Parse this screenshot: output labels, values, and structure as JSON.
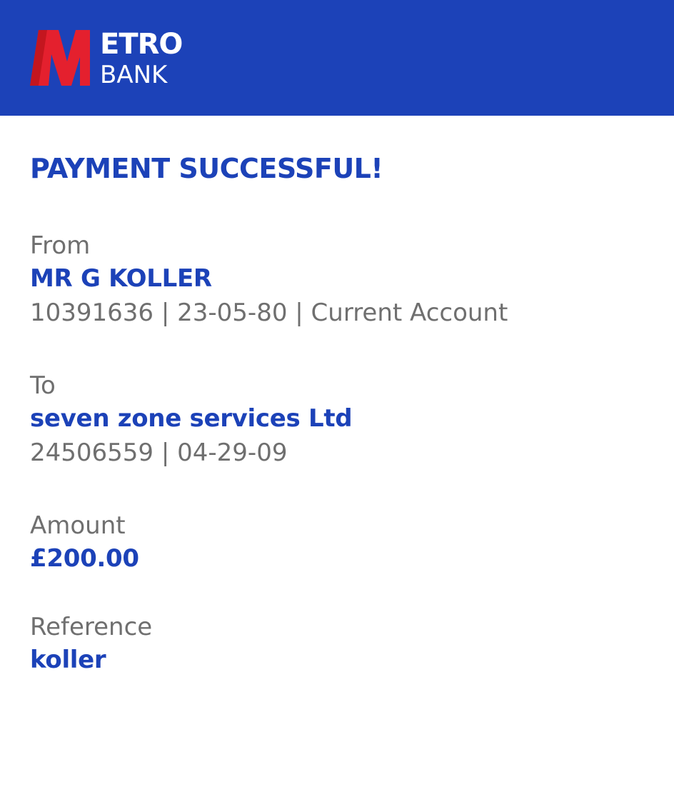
{
  "brand": {
    "word_top": "ETRO",
    "word_bottom": "BANK",
    "colors": {
      "header_bg": "#1c42b8",
      "logo_red": "#e4202e",
      "text_blue": "#1c42b8",
      "text_grey": "#6f6f6f"
    }
  },
  "receipt": {
    "title": "PAYMENT SUCCESSFUL!",
    "from": {
      "label": "From",
      "name": "MR G KOLLER",
      "details": "10391636 | 23-05-80 | Current Account"
    },
    "to": {
      "label": "To",
      "name": "seven zone services Ltd",
      "details": "24506559 | 04-29-09"
    },
    "amount": {
      "label": "Amount",
      "value": "£200.00"
    },
    "reference": {
      "label": "Reference",
      "value": "koller"
    }
  }
}
